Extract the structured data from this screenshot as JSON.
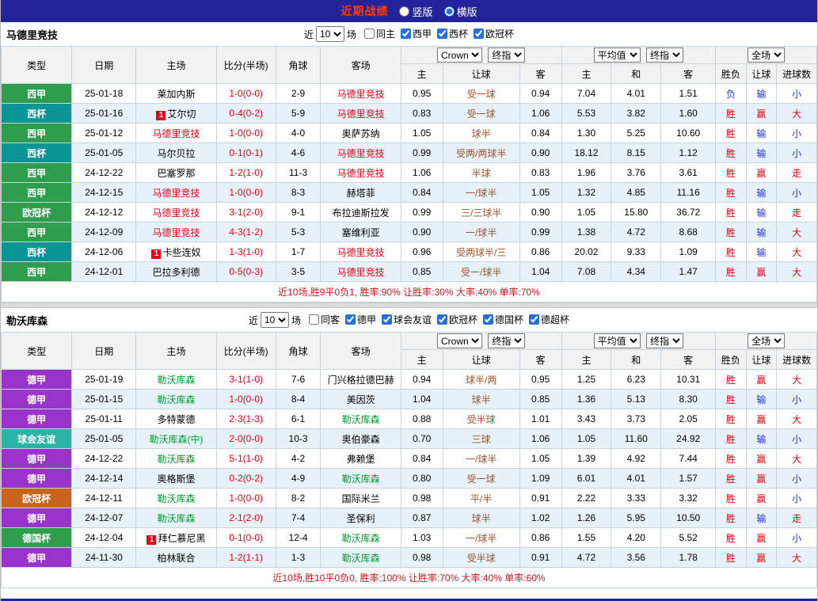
{
  "topbar": {
    "title": "近期战绩",
    "radios": [
      {
        "label": "竖版",
        "checked": false
      },
      {
        "label": "横版",
        "checked": true
      }
    ]
  },
  "table_header": {
    "book_select": "Crown",
    "final_select": "终指",
    "avg_select": "平均值",
    "scope_select": "全场",
    "left_columns": [
      "类型",
      "日期",
      "主场",
      "比分(半场)",
      "角球",
      "客场"
    ],
    "odds_sub": [
      "主",
      "让球",
      "客"
    ],
    "avg_sub": [
      "主",
      "和",
      "客"
    ],
    "result_sub": [
      "胜负",
      "让球",
      "进球数"
    ]
  },
  "colors": {
    "navy": "#22229a",
    "title": "#ff3c00",
    "red": "#e60012",
    "blue": "#2433cc",
    "hcap": "#a0522d",
    "grid": "#c6d3e1",
    "headbg": "#f2f2f2",
    "altrow": "#e6f1fa",
    "summary": "#c81822",
    "sep": "#dcdcdc"
  },
  "sections": [
    {
      "team": "马德里竞技",
      "focus_color": "#e60012",
      "filter": {
        "near": "近",
        "count": "10",
        "unit": "场",
        "checkboxes": [
          {
            "label": "同主",
            "checked": false
          },
          {
            "label": "西甲",
            "checked": true
          },
          {
            "label": "西杯",
            "checked": true
          },
          {
            "label": "欧冠杯",
            "checked": true
          }
        ]
      },
      "rows": [
        {
          "league": "西甲",
          "league_color": "#2e9e4e",
          "date": "25-01-18",
          "home": "莱加内斯",
          "home_badge": "",
          "home_focus": false,
          "score": "1-0(0-0)",
          "corners": "2-9",
          "away": "马德里竞技",
          "away_focus": true,
          "o1": "0.95",
          "hcap": "受一球",
          "o2": "0.94",
          "a1": "7.04",
          "a2": "4.01",
          "a3": "1.51",
          "r1": "负",
          "r2": "输",
          "r3": "小"
        },
        {
          "league": "西杯",
          "league_color": "#0b9494",
          "date": "25-01-16",
          "home": "艾尔切",
          "home_badge": "1",
          "home_focus": false,
          "score": "0-4(0-2)",
          "corners": "5-9",
          "away": "马德里竞技",
          "away_focus": true,
          "o1": "0.83",
          "hcap": "受一球",
          "o2": "1.06",
          "a1": "5.53",
          "a2": "3.82",
          "a3": "1.60",
          "r1": "胜",
          "r2": "赢",
          "r3": "大"
        },
        {
          "league": "西甲",
          "league_color": "#2e9e4e",
          "date": "25-01-12",
          "home": "马德里竞技",
          "home_badge": "",
          "home_focus": true,
          "score": "1-0(0-0)",
          "corners": "4-0",
          "away": "奥萨苏纳",
          "away_focus": false,
          "o1": "1.05",
          "hcap": "球半",
          "o2": "0.84",
          "a1": "1.30",
          "a2": "5.25",
          "a3": "10.60",
          "r1": "胜",
          "r2": "输",
          "r3": "小"
        },
        {
          "league": "西杯",
          "league_color": "#0b9494",
          "date": "25-01-05",
          "home": "马尔贝拉",
          "home_badge": "",
          "home_focus": false,
          "score": "0-1(0-1)",
          "corners": "4-6",
          "away": "马德里竞技",
          "away_focus": true,
          "o1": "0.99",
          "hcap": "受两/两球半",
          "o2": "0.90",
          "a1": "18.12",
          "a2": "8.15",
          "a3": "1.12",
          "r1": "胜",
          "r2": "输",
          "r3": "小"
        },
        {
          "league": "西甲",
          "league_color": "#2e9e4e",
          "date": "24-12-22",
          "home": "巴塞罗那",
          "home_badge": "",
          "home_focus": false,
          "score": "1-2(1-0)",
          "corners": "11-3",
          "away": "马德里竞技",
          "away_focus": true,
          "o1": "1.06",
          "hcap": "半球",
          "o2": "0.83",
          "a1": "1.96",
          "a2": "3.76",
          "a3": "3.61",
          "r1": "胜",
          "r2": "赢",
          "r3": "走"
        },
        {
          "league": "西甲",
          "league_color": "#2e9e4e",
          "date": "24-12-15",
          "home": "马德里竞技",
          "home_badge": "",
          "home_focus": true,
          "score": "1-0(0-0)",
          "corners": "8-3",
          "away": "赫塔菲",
          "away_focus": false,
          "o1": "0.84",
          "hcap": "一/球半",
          "o2": "1.05",
          "a1": "1.32",
          "a2": "4.85",
          "a3": "11.16",
          "r1": "胜",
          "r2": "输",
          "r3": "小"
        },
        {
          "league": "欧冠杯",
          "league_color": "#2e9e4e",
          "date": "24-12-12",
          "home": "马德里竞技",
          "home_badge": "",
          "home_focus": true,
          "score": "3-1(2-0)",
          "corners": "9-1",
          "away": "布拉迪斯拉发",
          "away_focus": false,
          "o1": "0.99",
          "hcap": "三/三球半",
          "o2": "0.90",
          "a1": "1.05",
          "a2": "15.80",
          "a3": "36.72",
          "r1": "胜",
          "r2": "输",
          "r3": "走"
        },
        {
          "league": "西甲",
          "league_color": "#2e9e4e",
          "date": "24-12-09",
          "home": "马德里竞技",
          "home_badge": "",
          "home_focus": true,
          "score": "4-3(1-2)",
          "corners": "5-3",
          "away": "塞维利亚",
          "away_focus": false,
          "o1": "0.90",
          "hcap": "一/球半",
          "o2": "0.99",
          "a1": "1.38",
          "a2": "4.72",
          "a3": "8.68",
          "r1": "胜",
          "r2": "输",
          "r3": "大"
        },
        {
          "league": "西杯",
          "league_color": "#0b9494",
          "date": "24-12-06",
          "home": "卡些连奴",
          "home_badge": "1",
          "home_focus": false,
          "score": "1-3(1-0)",
          "corners": "1-7",
          "away": "马德里竞技",
          "away_focus": true,
          "o1": "0.96",
          "hcap": "受两球半/三",
          "o2": "0.86",
          "a1": "20.02",
          "a2": "9.33",
          "a3": "1.09",
          "r1": "胜",
          "r2": "输",
          "r3": "大"
        },
        {
          "league": "西甲",
          "league_color": "#2e9e4e",
          "date": "24-12-01",
          "home": "巴拉多利德",
          "home_badge": "",
          "home_focus": false,
          "score": "0-5(0-3)",
          "corners": "3-5",
          "away": "马德里竞技",
          "away_focus": true,
          "o1": "0.85",
          "hcap": "受一/球半",
          "o2": "1.04",
          "a1": "7.08",
          "a2": "4.34",
          "a3": "1.47",
          "r1": "胜",
          "r2": "赢",
          "r3": "大"
        }
      ],
      "summary": "近10场,胜9平0负1, 胜率:90% 让胜率:30% 大率:40% 单率:70%"
    },
    {
      "team": "勒沃库森",
      "focus_color": "#009933",
      "filter": {
        "near": "近",
        "count": "10",
        "unit": "场",
        "checkboxes": [
          {
            "label": "同客",
            "checked": false
          },
          {
            "label": "德甲",
            "checked": true
          },
          {
            "label": "球会友谊",
            "checked": true
          },
          {
            "label": "欧冠杯",
            "checked": true
          },
          {
            "label": "德国杯",
            "checked": true
          },
          {
            "label": "德超杯",
            "checked": true
          }
        ]
      },
      "rows": [
        {
          "league": "德甲",
          "league_color": "#9933cc",
          "date": "25-01-19",
          "home": "勒沃库森",
          "home_badge": "",
          "home_focus": true,
          "score": "3-1(1-0)",
          "corners": "7-6",
          "away": "门兴格拉德巴赫",
          "away_focus": false,
          "o1": "0.94",
          "hcap": "球半/两",
          "o2": "0.95",
          "a1": "1.25",
          "a2": "6.23",
          "a3": "10.31",
          "r1": "胜",
          "r2": "赢",
          "r3": "大"
        },
        {
          "league": "德甲",
          "league_color": "#9933cc",
          "date": "25-01-15",
          "home": "勒沃库森",
          "home_badge": "",
          "home_focus": true,
          "score": "1-0(0-0)",
          "corners": "8-4",
          "away": "美因茨",
          "away_focus": false,
          "o1": "1.04",
          "hcap": "球半",
          "o2": "0.85",
          "a1": "1.36",
          "a2": "5.13",
          "a3": "8.30",
          "r1": "胜",
          "r2": "输",
          "r3": "小"
        },
        {
          "league": "德甲",
          "league_color": "#9933cc",
          "date": "25-01-11",
          "home": "多特蒙德",
          "home_badge": "",
          "home_focus": false,
          "score": "2-3(1-3)",
          "corners": "6-1",
          "away": "勒沃库森",
          "away_focus": true,
          "o1": "0.88",
          "hcap": "受半球",
          "o2": "1.01",
          "a1": "3.43",
          "a2": "3.73",
          "a3": "2.05",
          "r1": "胜",
          "r2": "赢",
          "r3": "大"
        },
        {
          "league": "球会友谊",
          "league_color": "#2cb3a8",
          "date": "25-01-05",
          "home": "勒沃库森(中)",
          "home_badge": "",
          "home_focus": true,
          "score": "2-0(0-0)",
          "corners": "10-3",
          "away": "奥伯豪森",
          "away_focus": false,
          "o1": "0.70",
          "hcap": "三球",
          "o2": "1.06",
          "a1": "1.05",
          "a2": "11.60",
          "a3": "24.92",
          "r1": "胜",
          "r2": "输",
          "r3": "小"
        },
        {
          "league": "德甲",
          "league_color": "#9933cc",
          "date": "24-12-22",
          "home": "勒沃库森",
          "home_badge": "",
          "home_focus": true,
          "score": "5-1(1-0)",
          "corners": "4-2",
          "away": "弗赖堡",
          "away_focus": false,
          "o1": "0.84",
          "hcap": "一/球半",
          "o2": "1.05",
          "a1": "1.39",
          "a2": "4.92",
          "a3": "7.44",
          "r1": "胜",
          "r2": "赢",
          "r3": "大"
        },
        {
          "league": "德甲",
          "league_color": "#9933cc",
          "date": "24-12-14",
          "home": "奥格斯堡",
          "home_badge": "",
          "home_focus": false,
          "score": "0-2(0-2)",
          "corners": "4-9",
          "away": "勒沃库森",
          "away_focus": true,
          "o1": "0.80",
          "hcap": "受一球",
          "o2": "1.09",
          "a1": "6.01",
          "a2": "4.01",
          "a3": "1.57",
          "r1": "胜",
          "r2": "赢",
          "r3": "小"
        },
        {
          "league": "欧冠杯",
          "league_color": "#c8641c",
          "date": "24-12-11",
          "home": "勒沃库森",
          "home_badge": "",
          "home_focus": true,
          "score": "1-0(0-0)",
          "corners": "8-2",
          "away": "国际米兰",
          "away_focus": false,
          "o1": "0.98",
          "hcap": "平/半",
          "o2": "0.91",
          "a1": "2.22",
          "a2": "3.33",
          "a3": "3.32",
          "r1": "胜",
          "r2": "赢",
          "r3": "小"
        },
        {
          "league": "德甲",
          "league_color": "#9933cc",
          "date": "24-12-07",
          "home": "勒沃库森",
          "home_badge": "",
          "home_focus": true,
          "score": "2-1(2-0)",
          "corners": "7-4",
          "away": "圣保利",
          "away_focus": false,
          "o1": "0.87",
          "hcap": "球半",
          "o2": "1.02",
          "a1": "1.26",
          "a2": "5.95",
          "a3": "10.50",
          "r1": "胜",
          "r2": "输",
          "r3": "走"
        },
        {
          "league": "德国杯",
          "league_color": "#2e9e4e",
          "date": "24-12-04",
          "home": "拜仁慕尼黑",
          "home_badge": "1",
          "home_focus": false,
          "score": "0-1(0-0)",
          "corners": "12-4",
          "away": "勒沃库森",
          "away_focus": true,
          "o1": "1.03",
          "hcap": "一/球半",
          "o2": "0.86",
          "a1": "1.55",
          "a2": "4.20",
          "a3": "5.52",
          "r1": "胜",
          "r2": "赢",
          "r3": "小"
        },
        {
          "league": "德甲",
          "league_color": "#9933cc",
          "date": "24-11-30",
          "home": "柏林联合",
          "home_badge": "",
          "home_focus": false,
          "score": "1-2(1-1)",
          "corners": "1-3",
          "away": "勒沃库森",
          "away_focus": true,
          "o1": "0.98",
          "hcap": "受半球",
          "o2": "0.91",
          "a1": "4.72",
          "a2": "3.56",
          "a3": "1.78",
          "r1": "胜",
          "r2": "赢",
          "r3": "大"
        }
      ],
      "summary": "近10场,胜10平0负0, 胜率:100% 让胜率:70% 大率:40% 单率:60%"
    }
  ]
}
